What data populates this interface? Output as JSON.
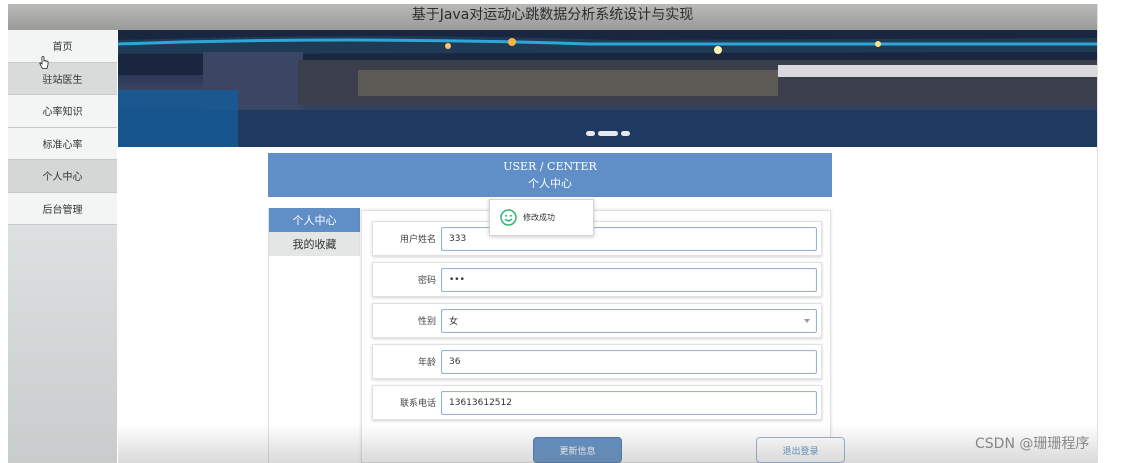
{
  "header": {
    "title": "基于Java对运动心跳数据分析系统设计与实现"
  },
  "sidebar": {
    "items": [
      {
        "label": "首页"
      },
      {
        "label": "驻站医生"
      },
      {
        "label": "心率知识"
      },
      {
        "label": "标准心率"
      },
      {
        "label": "个人中心"
      },
      {
        "label": "后台管理"
      }
    ]
  },
  "center_header": {
    "en": "USER / CENTER",
    "cn": "个人中心"
  },
  "tabs": [
    {
      "label": "个人中心",
      "active": true
    },
    {
      "label": "我的收藏",
      "active": false
    }
  ],
  "form": {
    "username": {
      "label": "用户姓名",
      "value": "333"
    },
    "password": {
      "label": "密码",
      "value": "•••"
    },
    "gender": {
      "label": "性别",
      "value": "女"
    },
    "age": {
      "label": "年龄",
      "value": "36"
    },
    "phone": {
      "label": "联系电话",
      "value": "13613612512"
    }
  },
  "buttons": {
    "update": "更新信息",
    "logout": "退出登录"
  },
  "toast": {
    "message": "修改成功"
  },
  "watermark": "CSDN @珊珊程序",
  "colors": {
    "accent": "#5f8fc6",
    "titlebar": "#a8a9a6",
    "toast_icon": "#2bb673"
  }
}
